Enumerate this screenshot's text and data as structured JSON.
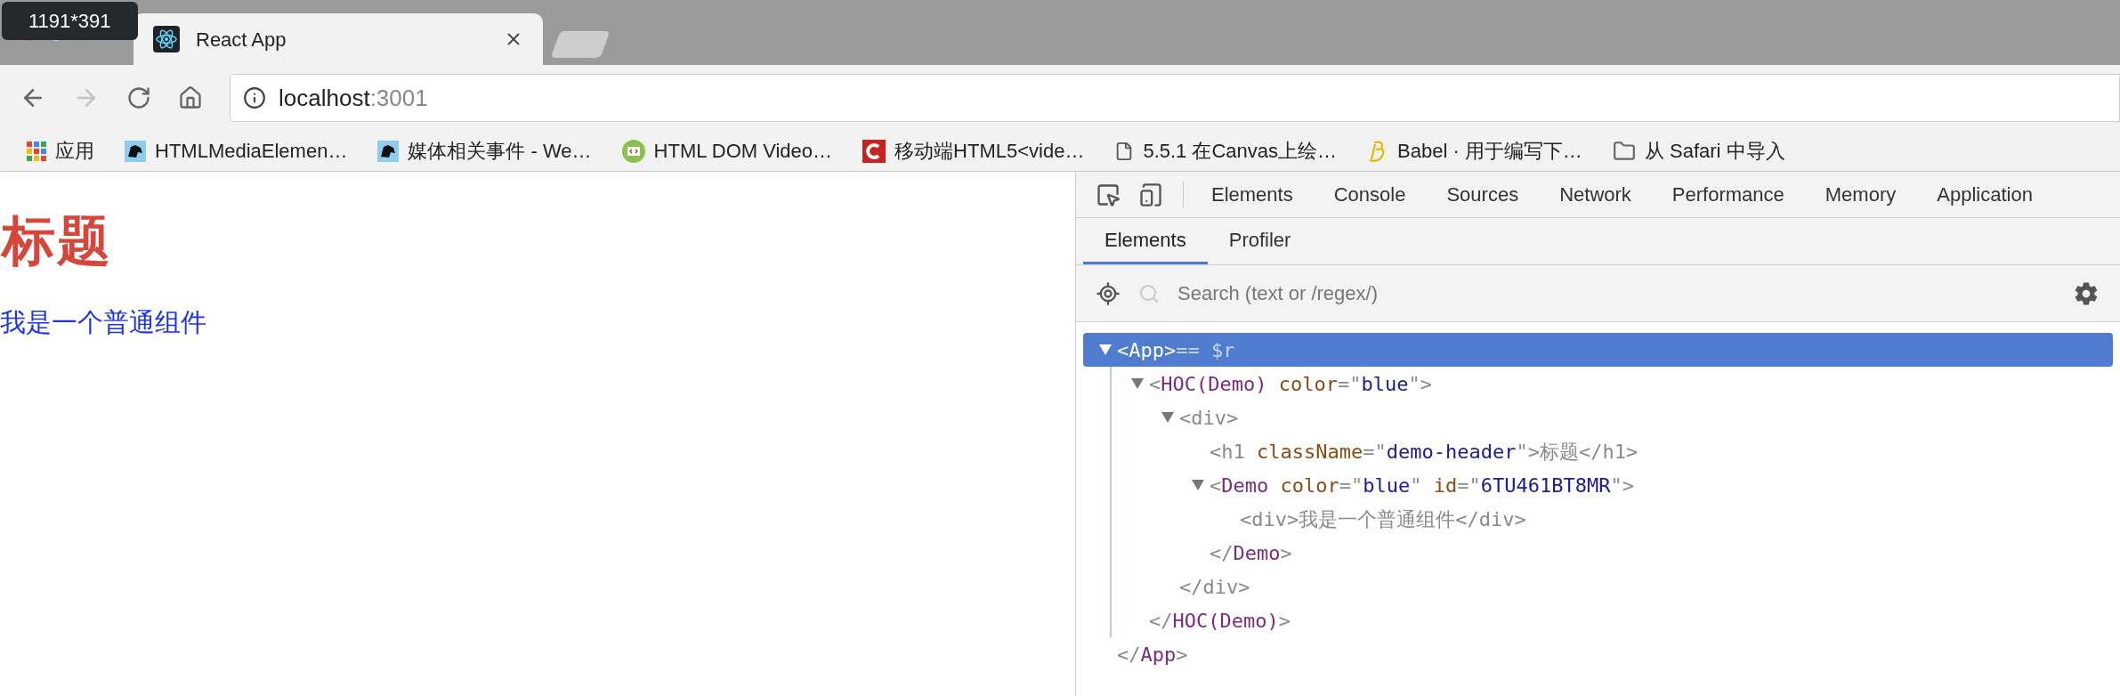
{
  "overlay": {
    "label": "1191*391"
  },
  "tabs": [
    {
      "title": "React App",
      "selected": true
    }
  ],
  "nav": {
    "forward_disabled": true
  },
  "address": {
    "host": "localhost",
    "port": ":3001"
  },
  "bookmarks": [
    {
      "kind": "grid",
      "label": "应用"
    },
    {
      "kind": "tile",
      "label": "HTMLMediaElemen…"
    },
    {
      "kind": "tile",
      "label": "媒体相关事件 - We…"
    },
    {
      "kind": "badge",
      "label": "HTML DOM Video…"
    },
    {
      "kind": "logo",
      "label": "移动端HTML5<vide…"
    },
    {
      "kind": "doc",
      "label": "5.5.1 在Canvas上绘…"
    },
    {
      "kind": "script",
      "label": "Babel · 用于编写下…"
    },
    {
      "kind": "folder",
      "label": "从 Safari 中导入"
    }
  ],
  "page": {
    "heading": "标题",
    "text": "我是一个普通组件"
  },
  "devtools": {
    "tabs": [
      {
        "label": "Elements",
        "selected": false
      },
      {
        "label": "Console",
        "selected": false
      },
      {
        "label": "Sources",
        "selected": false
      },
      {
        "label": "Network",
        "selected": false
      },
      {
        "label": "Performance",
        "selected": false
      },
      {
        "label": "Memory",
        "selected": false
      },
      {
        "label": "Application",
        "selected": false
      }
    ],
    "subtabs": [
      {
        "label": "Elements",
        "selected": true
      },
      {
        "label": "Profiler",
        "selected": false
      }
    ],
    "search": {
      "placeholder": "Search (text or /regex/)"
    },
    "tree": [
      {
        "selected": true,
        "expanded": true,
        "open": [
          {
            "kind": "punct",
            "text": "<"
          },
          {
            "kind": "component",
            "text": "App"
          },
          {
            "kind": "punct",
            "text": ">"
          },
          {
            "kind": "ref",
            "text": "== $r"
          }
        ],
        "close": [
          {
            "kind": "punct",
            "text": "</"
          },
          {
            "kind": "component",
            "text": "App"
          },
          {
            "kind": "punct",
            "text": ">"
          }
        ],
        "children": [
          {
            "selected": false,
            "expanded": true,
            "open": [
              {
                "kind": "punct",
                "text": "<"
              },
              {
                "kind": "component",
                "text": "HOC(Demo)"
              },
              {
                "kind": "attr",
                "text": " color"
              },
              {
                "kind": "punct",
                "text": "=\""
              },
              {
                "kind": "value",
                "text": "blue"
              },
              {
                "kind": "punct",
                "text": "\">"
              }
            ],
            "close": [
              {
                "kind": "punct",
                "text": "</"
              },
              {
                "kind": "component",
                "text": "HOC(Demo)"
              },
              {
                "kind": "punct",
                "text": ">"
              }
            ],
            "children": [
              {
                "selected": false,
                "expanded": true,
                "open": [
                  {
                    "kind": "punct",
                    "text": "<div>"
                  }
                ],
                "close": [
                  {
                    "kind": "punct",
                    "text": "</div>"
                  }
                ],
                "children": [
                  {
                    "selected": false,
                    "open": [
                      {
                        "kind": "punct",
                        "text": "<h1"
                      },
                      {
                        "kind": "attr",
                        "text": " className"
                      },
                      {
                        "kind": "punct",
                        "text": "=\""
                      },
                      {
                        "kind": "value",
                        "text": "demo-header"
                      },
                      {
                        "kind": "punct",
                        "text": "\">标题</h1>"
                      }
                    ]
                  },
                  {
                    "selected": false,
                    "expanded": true,
                    "open": [
                      {
                        "kind": "punct",
                        "text": "<"
                      },
                      {
                        "kind": "component",
                        "text": "Demo"
                      },
                      {
                        "kind": "attr",
                        "text": " color"
                      },
                      {
                        "kind": "punct",
                        "text": "=\""
                      },
                      {
                        "kind": "value",
                        "text": "blue"
                      },
                      {
                        "kind": "punct",
                        "text": "\""
                      },
                      {
                        "kind": "attr",
                        "text": " id"
                      },
                      {
                        "kind": "punct",
                        "text": "=\""
                      },
                      {
                        "kind": "value",
                        "text": "6TU461BT8MR"
                      },
                      {
                        "kind": "punct",
                        "text": "\">"
                      }
                    ],
                    "close": [
                      {
                        "kind": "punct",
                        "text": "</"
                      },
                      {
                        "kind": "component",
                        "text": "Demo"
                      },
                      {
                        "kind": "punct",
                        "text": ">"
                      }
                    ],
                    "children": [
                      {
                        "selected": false,
                        "open": [
                          {
                            "kind": "punct",
                            "text": "<div>我是一个普通组件</div>"
                          }
                        ]
                      }
                    ]
                  }
                ]
              }
            ]
          }
        ]
      }
    ]
  }
}
